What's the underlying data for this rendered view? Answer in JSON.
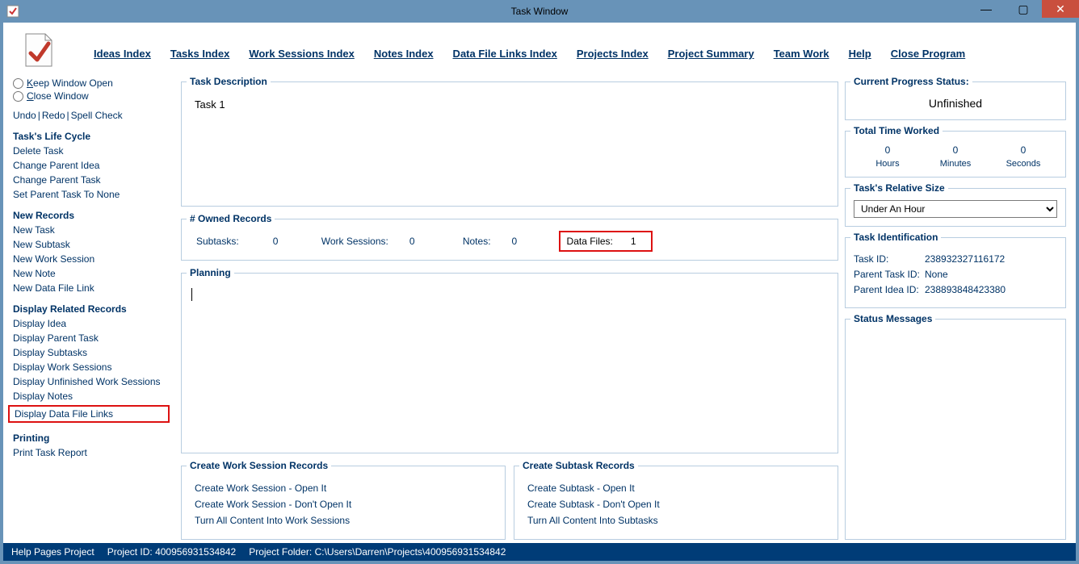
{
  "window": {
    "title": "Task Window"
  },
  "menu": {
    "items": [
      {
        "label": "Ideas Index",
        "u": "I"
      },
      {
        "label": "Tasks Index",
        "u": "T"
      },
      {
        "label": "Work Sessions Index",
        "u": "W"
      },
      {
        "label": "Notes Index",
        "u": "N"
      },
      {
        "label": "Data File Links Index",
        "u": "D"
      },
      {
        "label": "Projects Index",
        "u": null
      },
      {
        "label": "Project Summary",
        "u": "P"
      },
      {
        "label": "Team Work",
        "u": null
      },
      {
        "label": "Help",
        "u": "H"
      },
      {
        "label": "Close Program",
        "u": "C"
      }
    ]
  },
  "sidebar": {
    "keep_open": "Keep Window Open",
    "close_window": "Close Window",
    "keep_open_u": "K",
    "close_window_u": "C",
    "toolbar": {
      "undo": "Undo",
      "redo": "Redo",
      "spell": "Spell Check"
    },
    "lifecycle": {
      "heading": "Task's Life Cycle",
      "delete": "Delete Task",
      "change_parent_idea": "Change Parent Idea",
      "change_parent_task": "Change Parent Task",
      "set_parent_none": "Set Parent Task To None"
    },
    "new_records": {
      "heading": "New Records",
      "new_task": "New Task",
      "new_subtask": "New Subtask",
      "new_work_session": "New Work Session",
      "new_note": "New Note",
      "new_data_file_link": "New Data File Link"
    },
    "display": {
      "heading": "Display Related Records",
      "display_idea": "Display Idea",
      "display_parent_task": "Display Parent Task",
      "display_subtasks": "Display Subtasks",
      "display_work_sessions": "Display Work Sessions",
      "display_unfinished_ws": "Display Unfinished Work Sessions",
      "display_notes": "Display Notes",
      "display_data_file_links": "Display Data File Links"
    },
    "printing": {
      "heading": "Printing",
      "print_report": "Print Task Report"
    }
  },
  "main": {
    "task_description": {
      "heading": "Task Description",
      "value": "Task 1"
    },
    "owned": {
      "heading": "# Owned Records",
      "subtasks_label": "Subtasks:",
      "subtasks_val": "0",
      "work_sessions_label": "Work Sessions:",
      "work_sessions_val": "0",
      "notes_label": "Notes:",
      "notes_val": "0",
      "data_files_label": "Data Files:",
      "data_files_val": "1"
    },
    "planning": {
      "heading": "Planning"
    },
    "create_ws": {
      "heading": "Create Work Session Records",
      "open": "Create Work Session - Open It",
      "dont_open": "Create Work Session - Don't Open It",
      "turn_all": "Turn All Content Into Work Sessions"
    },
    "create_sub": {
      "heading": "Create Subtask Records",
      "open": "Create Subtask - Open It",
      "dont_open": "Create Subtask - Don't Open It",
      "turn_all": "Turn All Content Into Subtasks"
    }
  },
  "right": {
    "progress": {
      "heading": "Current Progress Status:",
      "value": "Unfinished"
    },
    "time": {
      "heading": "Total Time Worked",
      "hours_val": "0",
      "hours_label": "Hours",
      "minutes_val": "0",
      "minutes_label": "Minutes",
      "seconds_val": "0",
      "seconds_label": "Seconds"
    },
    "relsize": {
      "heading": "Task's Relative Size",
      "selected": "Under An Hour"
    },
    "ident": {
      "heading": "Task Identification",
      "task_id_label": "Task ID:",
      "task_id_val": "238932327116172",
      "parent_task_label": "Parent Task ID:",
      "parent_task_val": "None",
      "parent_idea_label": "Parent Idea ID:",
      "parent_idea_val": "238893848423380"
    },
    "status_msgs": {
      "heading": "Status Messages"
    }
  },
  "statusbar": {
    "help": "Help Pages Project",
    "project_id": "Project ID: 400956931534842",
    "project_folder": "Project Folder: C:\\Users\\Darren\\Projects\\400956931534842"
  }
}
